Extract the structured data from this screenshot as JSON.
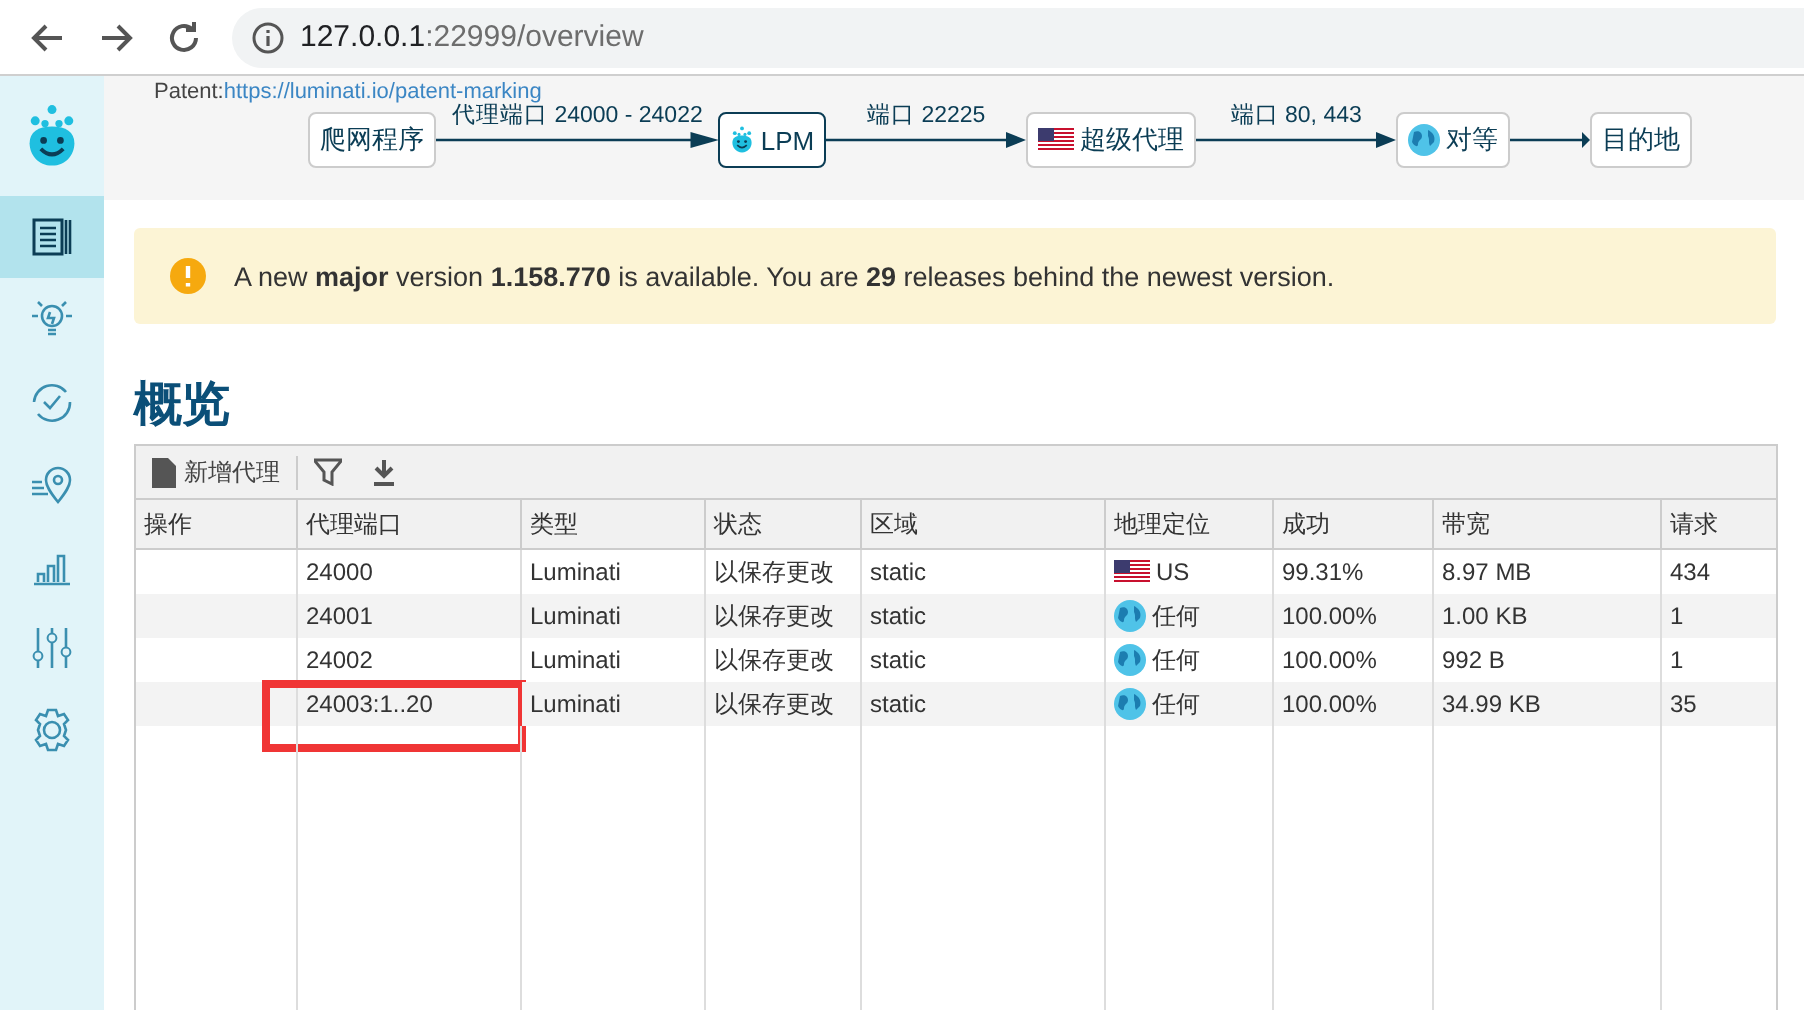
{
  "browser": {
    "host": "127.0.0.1",
    "path": ":22999/overview"
  },
  "sidebar": {
    "items": [
      {
        "kind": "docs",
        "selected": true
      },
      {
        "kind": "bulb",
        "selected": false
      },
      {
        "kind": "refresh",
        "selected": false
      },
      {
        "kind": "pin",
        "selected": false
      },
      {
        "kind": "chart",
        "selected": false
      },
      {
        "kind": "sliders",
        "selected": false
      },
      {
        "kind": "gear",
        "selected": false
      }
    ]
  },
  "patent": {
    "label": "Patent:",
    "link": "https://luminati.io/patent-marking"
  },
  "flow": [
    {
      "label": "爬网程序",
      "kind": "plain",
      "next_label": "代理端口 24000 - 24022"
    },
    {
      "label": "LPM",
      "kind": "logo",
      "next_label": "端口 22225"
    },
    {
      "label": "超级代理",
      "kind": "flag",
      "next_label": "端口 80, 443"
    },
    {
      "label": "对等",
      "kind": "globe"
    },
    {
      "label": "目的地",
      "kind": "plain"
    }
  ],
  "alert": {
    "text": "A new **major** version **1.158.770** is available. You are **29** releases behind the newest version."
  },
  "title": "概览",
  "toolbar": {
    "add_label": "新增代理"
  },
  "table": {
    "columns": [
      "操作",
      "代理端口",
      "类型",
      "状态",
      "区域",
      "地理定位",
      "成功",
      "带宽",
      "请求"
    ],
    "rows": [
      {
        "port": "24000",
        "type": "Luminati",
        "status": "以保存更改",
        "zone": "static",
        "geo": {
          "kind": "flag",
          "text": "US"
        },
        "success": "99.31%",
        "bandwidth": "8.97 MB",
        "requests": "434",
        "highlighted": false
      },
      {
        "port": "24001",
        "type": "Luminati",
        "status": "以保存更改",
        "zone": "static",
        "geo": {
          "kind": "globe",
          "text": "任何"
        },
        "success": "100.00%",
        "bandwidth": "1.00 KB",
        "requests": "1",
        "highlighted": false
      },
      {
        "port": "24002",
        "type": "Luminati",
        "status": "以保存更改",
        "zone": "static",
        "geo": {
          "kind": "globe",
          "text": "任何"
        },
        "success": "100.00%",
        "bandwidth": "992 B",
        "requests": "1",
        "highlighted": false
      },
      {
        "port": "24003:1..20",
        "type": "Luminati",
        "status": "以保存更改",
        "zone": "static",
        "geo": {
          "kind": "globe",
          "text": "任何"
        },
        "success": "100.00%",
        "bandwidth": "34.99 KB",
        "requests": "35",
        "highlighted": true
      }
    ]
  }
}
